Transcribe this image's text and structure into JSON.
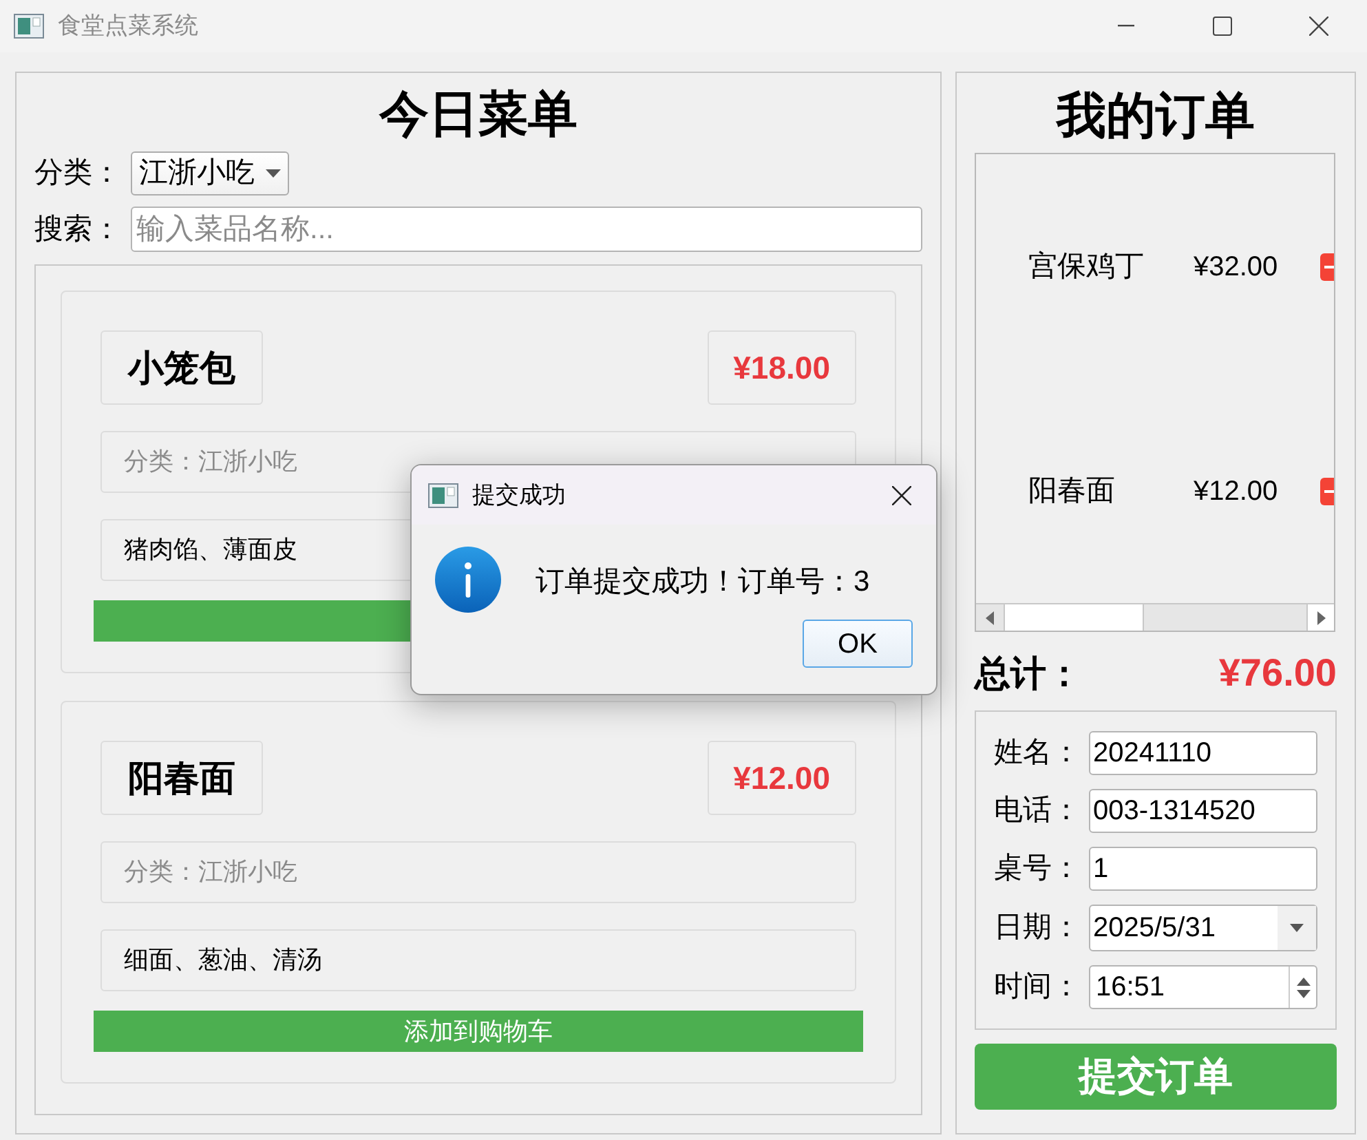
{
  "window": {
    "title": "食堂点菜系统"
  },
  "menu": {
    "title": "今日菜单",
    "category": {
      "label": "分类：",
      "value": "江浙小吃"
    },
    "search": {
      "label": "搜索：",
      "placeholder": "输入菜品名称..."
    },
    "dishes": [
      {
        "name": "小笼包",
        "price": "¥18.00",
        "category": "分类：江浙小吃",
        "description": "猪肉馅、薄面皮"
      },
      {
        "name": "阳春面",
        "price": "¥12.00",
        "category": "分类：江浙小吃",
        "description": "细面、葱油、清汤",
        "button": "添加到购物车"
      }
    ]
  },
  "order": {
    "title": "我的订单",
    "items": [
      {
        "name": "宫保鸡丁",
        "price": "¥32.00"
      },
      {
        "name": "阳春面",
        "price": "¥12.00"
      }
    ],
    "total_label": "总计：",
    "total": "¥76.00",
    "fields": [
      {
        "kind": "text",
        "label": "姓名：",
        "value": "20241110"
      },
      {
        "kind": "text",
        "label": "电话：",
        "value": "003-1314520"
      },
      {
        "kind": "text",
        "label": "桌号：",
        "value": "1"
      },
      {
        "kind": "date",
        "label": "日期：",
        "value": "2025/5/31"
      },
      {
        "kind": "time",
        "label": "时间：",
        "value": "16:51"
      }
    ],
    "submit": "提交订单"
  },
  "dialog": {
    "title": "提交成功",
    "message": "订单提交成功！订单号：3",
    "button": "OK"
  }
}
